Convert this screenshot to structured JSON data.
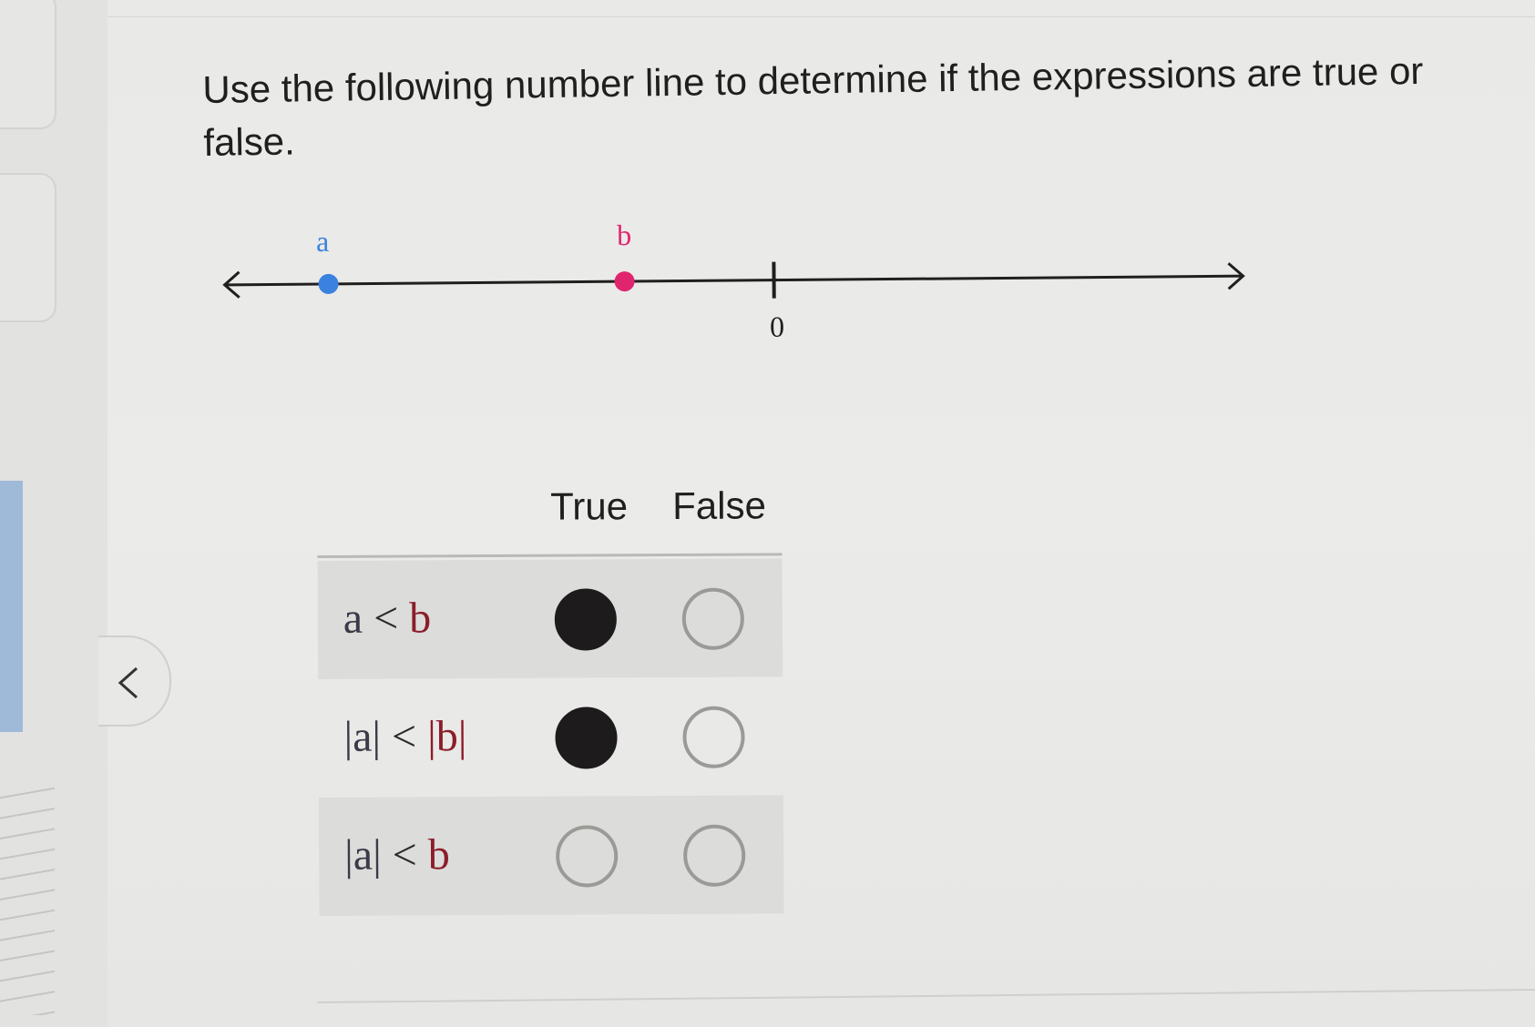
{
  "prompt": "Use the following number line to determine if the expressions are true or false.",
  "number_line": {
    "point_a_label": "a",
    "point_b_label": "b",
    "zero_label": "0",
    "point_a_color": "#3b82e0",
    "point_b_color": "#e0246e"
  },
  "table": {
    "headers": {
      "true": "True",
      "false": "False"
    },
    "rows": [
      {
        "expression_left": "a",
        "operator": "<",
        "expression_right": "b",
        "selected": "True"
      },
      {
        "expression_left": "|a|",
        "operator": "<",
        "expression_right": "|b|",
        "selected": "True"
      },
      {
        "expression_left": "|a|",
        "operator": "<",
        "expression_right": "b",
        "selected": ""
      }
    ]
  },
  "icons": {
    "prev": "chevron-left-icon"
  }
}
